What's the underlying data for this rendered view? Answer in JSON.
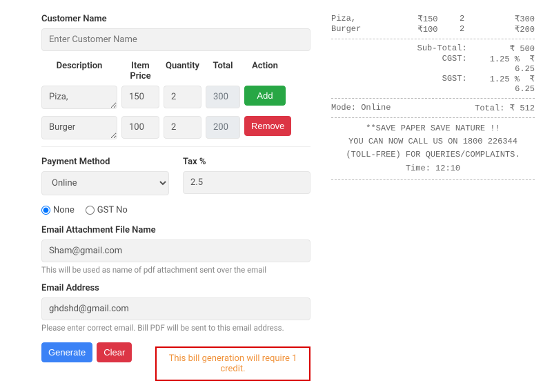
{
  "form": {
    "customer_label": "Customer Name",
    "customer_placeholder": "Enter Customer Name",
    "headers": {
      "description": "Description",
      "price": "Item Price",
      "qty": "Quantity",
      "total": "Total",
      "action": "Action"
    },
    "rows": [
      {
        "desc": "Piza,",
        "price": "150",
        "qty": "2",
        "total": "300",
        "action": "Add"
      },
      {
        "desc": "Burger",
        "price": "100",
        "qty": "2",
        "total": "200",
        "action": "Remove"
      }
    ],
    "payment": {
      "label": "Payment Method",
      "value": "Online"
    },
    "tax": {
      "label": "Tax %",
      "value": "2.5"
    },
    "gst": {
      "none": "None",
      "gstno": "GST No",
      "selected": "none"
    },
    "attach": {
      "label": "Email Attachment File Name",
      "value": "Sham@gmail.com",
      "hint": "This will be used as name of pdf attachment sent over the email"
    },
    "email": {
      "label": "Email Address",
      "value": "ghdshd@gmail.com",
      "hint": "Please enter correct email. Bill PDF will be sent to this email address."
    },
    "buttons": {
      "generate": "Generate",
      "clear": "Clear"
    },
    "credit_note": "This bill generation will require 1 credit."
  },
  "receipt": {
    "items": [
      {
        "name": "Piza,",
        "price": "₹150",
        "qty": "2",
        "total": "₹300"
      },
      {
        "name": "Burger",
        "price": "₹100",
        "qty": "2",
        "total": "₹200"
      }
    ],
    "subtotal_label": "Sub-Total:",
    "subtotal": "₹ 500",
    "cgst_label": "CGST:",
    "cgst_pct": "1.25 %",
    "cgst_amt": "₹ 6.25",
    "sgst_label": "SGST:",
    "sgst_pct": "1.25 %",
    "sgst_amt": "₹ 6.25",
    "mode_label": "Mode: Online",
    "grand_label": "Total: ₹ 512",
    "footer1": "**SAVE PAPER SAVE NATURE !!",
    "footer2": "YOU CAN NOW CALL US ON 1800 226344 (TOLL-FREE) FOR QUERIES/COMPLAINTS.",
    "footer3": "Time: 12:10"
  }
}
